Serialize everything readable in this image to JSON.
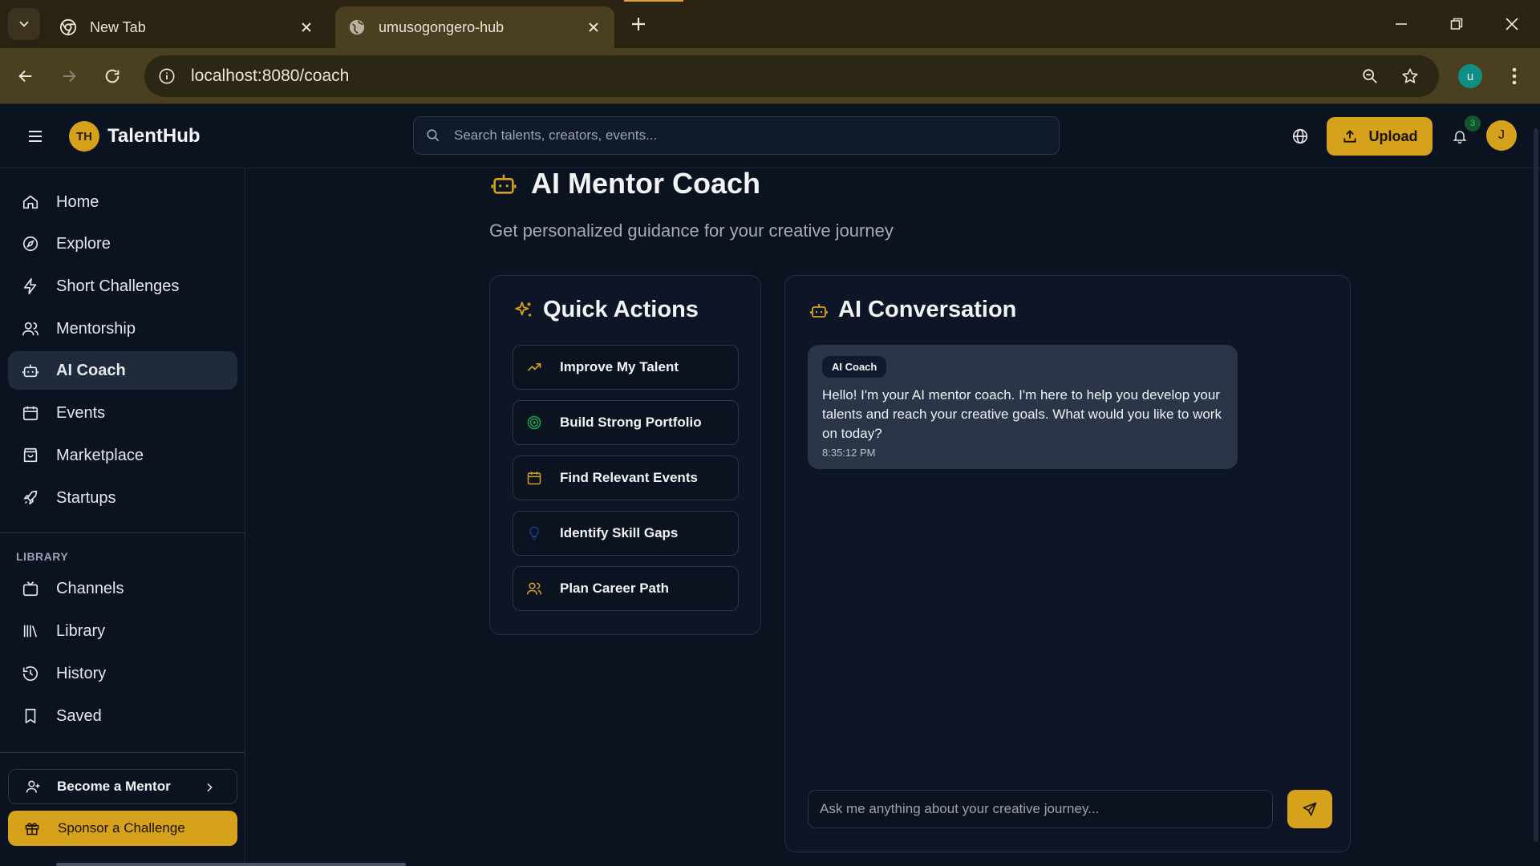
{
  "browser": {
    "tabs": [
      {
        "title": "New Tab",
        "favicon": "chrome-icon",
        "active": false
      },
      {
        "title": "umusogongero-hub",
        "favicon": "globe-icon",
        "active": true
      }
    ],
    "url": "localhost:8080/coach",
    "profile_initial": "u"
  },
  "app": {
    "logo_initials": "TH",
    "logo_name": "TalentHub",
    "search_placeholder": "Search talents, creators, events...",
    "upload_label": "Upload",
    "notification_count": "3",
    "user_initial": "J"
  },
  "sidebar": {
    "items": [
      {
        "label": "Home",
        "icon": "home-icon"
      },
      {
        "label": "Explore",
        "icon": "compass-icon"
      },
      {
        "label": "Short Challenges",
        "icon": "lightning-icon"
      },
      {
        "label": "Mentorship",
        "icon": "users-icon"
      },
      {
        "label": "AI Coach",
        "icon": "robot-icon",
        "active": true
      },
      {
        "label": "Events",
        "icon": "calendar-icon"
      },
      {
        "label": "Marketplace",
        "icon": "shopping-bag-icon"
      },
      {
        "label": "Startups",
        "icon": "rocket-icon"
      }
    ],
    "library_heading": "LIBRARY",
    "library_items": [
      {
        "label": "Channels",
        "icon": "tv-icon"
      },
      {
        "label": "Library",
        "icon": "library-icon"
      },
      {
        "label": "History",
        "icon": "history-icon"
      },
      {
        "label": "Saved",
        "icon": "bookmark-icon"
      }
    ],
    "become_mentor": "Become a Mentor",
    "sponsor_challenge": "Sponsor a Challenge"
  },
  "main": {
    "title": "AI Mentor Coach",
    "subtitle": "Get personalized guidance for your creative journey",
    "quick_actions": {
      "title": "Quick Actions",
      "items": [
        {
          "label": "Improve My Talent",
          "icon": "trending-up-icon",
          "color": "#d6a21b"
        },
        {
          "label": "Build Strong Portfolio",
          "icon": "target-icon",
          "color": "#16a34a"
        },
        {
          "label": "Find Relevant Events",
          "icon": "calendar-icon",
          "color": "#d6a21b"
        },
        {
          "label": "Identify Skill Gaps",
          "icon": "lightbulb-icon",
          "color": "#1e3a8a"
        },
        {
          "label": "Plan Career Path",
          "icon": "users-icon",
          "color": "#d6a21b"
        }
      ]
    },
    "conversation": {
      "title": "AI Conversation",
      "messages": [
        {
          "sender": "AI Coach",
          "text": "Hello! I'm your AI mentor coach. I'm here to help you develop your talents and reach your creative goals. What would you like to work on today?",
          "time": "8:35:12 PM"
        }
      ],
      "input_placeholder": "Ask me anything about your creative journey..."
    }
  },
  "colors": {
    "accent": "#d6a21b",
    "background": "#0b1220",
    "card": "#0d1526",
    "bubble": "#2a3547"
  }
}
